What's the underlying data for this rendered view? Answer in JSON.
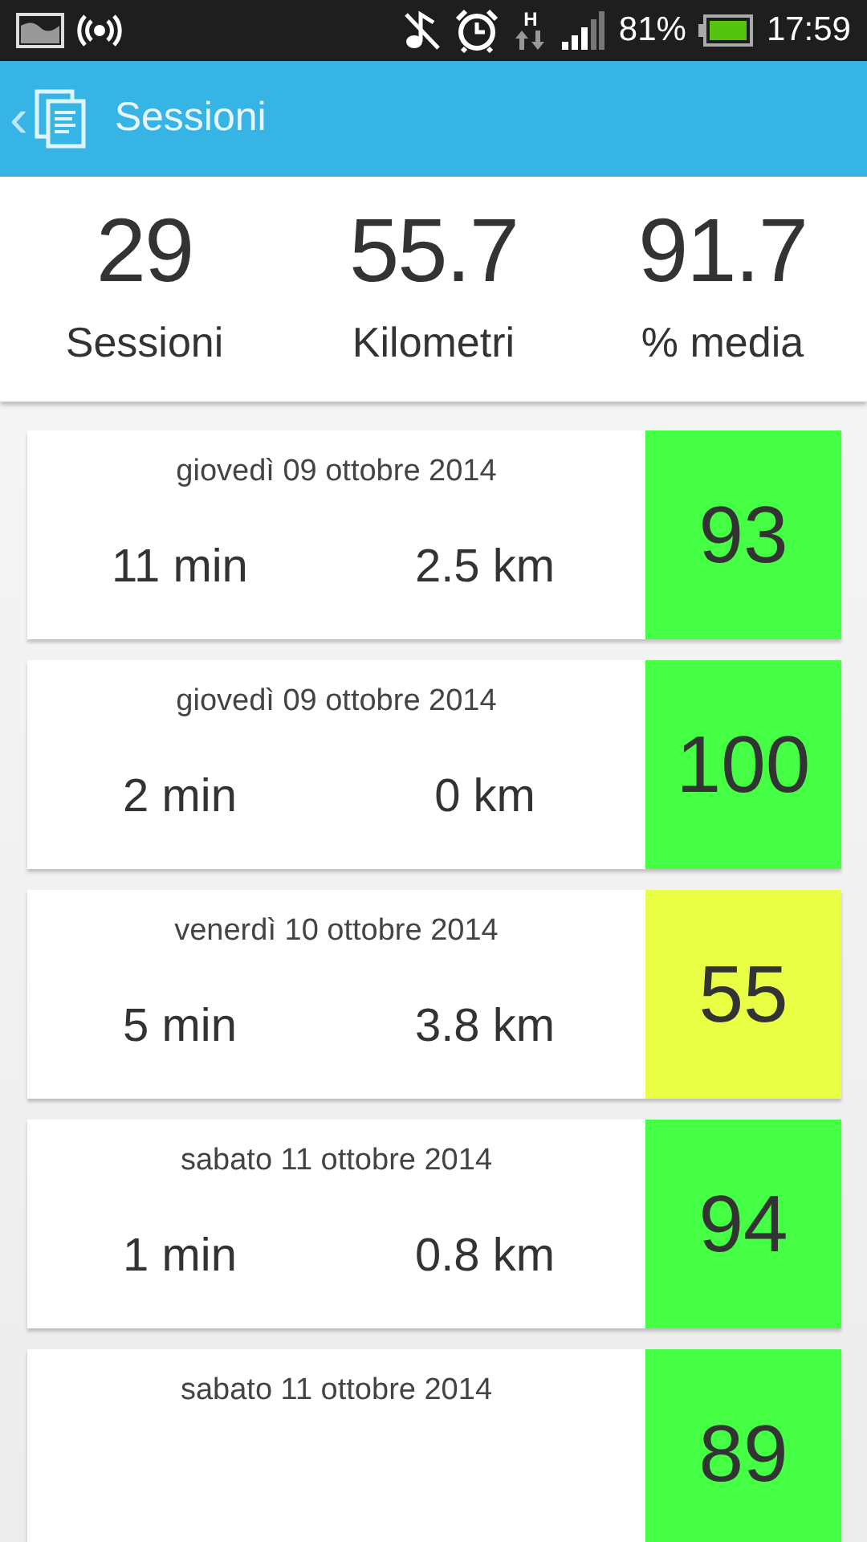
{
  "status_bar": {
    "network_type": "H",
    "battery": "81%",
    "time": "17:59"
  },
  "app_bar": {
    "back": "‹",
    "title": "Sessioni"
  },
  "summary": [
    {
      "value": "29",
      "label": "Sessioni"
    },
    {
      "value": "55.7",
      "label": "Kilometri"
    },
    {
      "value": "91.7",
      "label": "% media"
    }
  ],
  "sessions": [
    {
      "date": "giovedì 09 ottobre 2014",
      "duration": "11 min",
      "distance": "2.5 km",
      "score": "93",
      "color": "#44ff44"
    },
    {
      "date": "giovedì 09 ottobre 2014",
      "duration": "2 min",
      "distance": "0 km",
      "score": "100",
      "color": "#44ff44"
    },
    {
      "date": "venerdì 10 ottobre 2014",
      "duration": "5 min",
      "distance": "3.8 km",
      "score": "55",
      "color": "#e8ff44"
    },
    {
      "date": "sabato 11 ottobre 2014",
      "duration": "1 min",
      "distance": "0.8 km",
      "score": "94",
      "color": "#44ff44"
    },
    {
      "date": "sabato 11 ottobre 2014",
      "score": "89",
      "color": "#44ff44"
    }
  ]
}
